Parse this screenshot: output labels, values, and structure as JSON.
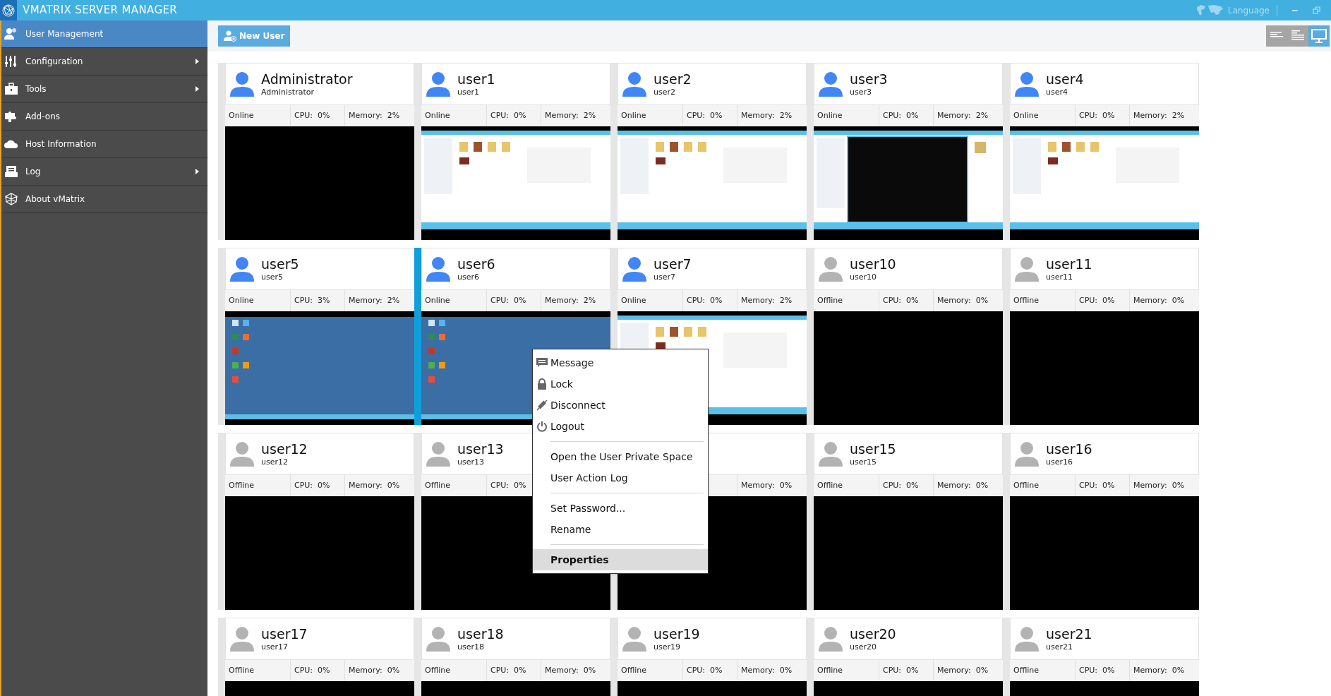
{
  "window": {
    "title": "VMATRIX SERVER MANAGER",
    "language": "Language"
  },
  "sidebar": {
    "items": [
      {
        "label": "User Management",
        "selected": true,
        "submenu": false
      },
      {
        "label": "Configuration",
        "selected": false,
        "submenu": true
      },
      {
        "label": "Tools",
        "selected": false,
        "submenu": true
      },
      {
        "label": "Add-ons",
        "selected": false,
        "submenu": false
      },
      {
        "label": "Host Information",
        "selected": false,
        "submenu": false
      },
      {
        "label": "Log",
        "selected": false,
        "submenu": true
      },
      {
        "label": "About vMatrix",
        "selected": false,
        "submenu": false
      }
    ]
  },
  "toolbar": {
    "new_user": "New User",
    "views": [
      {
        "selected": false
      },
      {
        "selected": false
      },
      {
        "selected": true
      }
    ]
  },
  "cards": [
    {
      "name": "Administrator",
      "login": "Administrator",
      "status": "Online",
      "online": true,
      "cpu": "CPU:  0%",
      "memory": "Memory:  2%",
      "selected": false
    },
    {
      "name": "user1",
      "login": "user1",
      "status": "Online",
      "online": true,
      "cpu": "CPU:  0%",
      "memory": "Memory:  2%",
      "selected": false
    },
    {
      "name": "user2",
      "login": "user2",
      "status": "Online",
      "online": true,
      "cpu": "CPU:  0%",
      "memory": "Memory:  2%",
      "selected": false
    },
    {
      "name": "user3",
      "login": "user3",
      "status": "Online",
      "online": true,
      "cpu": "CPU:  0%",
      "memory": "Memory:  2%",
      "selected": false
    },
    {
      "name": "user4",
      "login": "user4",
      "status": "Online",
      "online": true,
      "cpu": "CPU:  0%",
      "memory": "Memory:  2%",
      "selected": false
    },
    {
      "name": "user5",
      "login": "user5",
      "status": "Online",
      "online": true,
      "cpu": "CPU:  3%",
      "memory": "Memory:  2%",
      "selected": false
    },
    {
      "name": "user6",
      "login": "user6",
      "status": "Online",
      "online": true,
      "cpu": "CPU:  0%",
      "memory": "Memory:  2%",
      "selected": true
    },
    {
      "name": "user7",
      "login": "user7",
      "status": "Online",
      "online": true,
      "cpu": "CPU:  0%",
      "memory": "Memory:  2%",
      "selected": false
    },
    {
      "name": "user10",
      "login": "user10",
      "status": "Offline",
      "online": false,
      "cpu": "CPU:  0%",
      "memory": "Memory:  0%",
      "selected": false
    },
    {
      "name": "user11",
      "login": "user11",
      "status": "Offline",
      "online": false,
      "cpu": "CPU:  0%",
      "memory": "Memory:  0%",
      "selected": false
    },
    {
      "name": "user12",
      "login": "user12",
      "status": "Offline",
      "online": false,
      "cpu": "CPU:  0%",
      "memory": "Memory:  0%",
      "selected": false
    },
    {
      "name": "user13",
      "login": "user13",
      "status": "Offline",
      "online": false,
      "cpu": "CPU:  0%",
      "selected": false
    },
    {
      "memory": "Memory:  0%",
      "selected": false
    },
    {
      "name": "user15",
      "login": "user15",
      "status": "Offline",
      "online": false,
      "cpu": "CPU:  0%",
      "memory": "Memory:  0%",
      "selected": false
    },
    {
      "name": "user16",
      "login": "user16",
      "status": "Offline",
      "online": false,
      "cpu": "CPU:  0%",
      "memory": "Memory:  0%",
      "selected": false
    },
    {
      "name": "user17",
      "login": "user17",
      "status": "Offline",
      "online": false,
      "cpu": "CPU:  0%",
      "memory": "Memory:  0%",
      "selected": false
    },
    {
      "name": "user18",
      "login": "user18",
      "status": "Offline",
      "online": false,
      "cpu": "CPU:  0%",
      "memory": "Memory:  0%",
      "selected": false
    },
    {
      "name": "user19",
      "login": "user19",
      "status": "Offline",
      "online": false,
      "cpu": "CPU:  0%",
      "memory": "Memory:  0%",
      "selected": false
    },
    {
      "name": "user20",
      "login": "user20",
      "status": "Offline",
      "online": false,
      "cpu": "CPU:  0%",
      "memory": "Memory:  0%",
      "selected": false
    },
    {
      "name": "user21",
      "login": "user21",
      "status": "Offline",
      "online": false,
      "cpu": "CPU:  0%",
      "memory": "Memory:  0%",
      "selected": false
    }
  ],
  "context_menu": {
    "groups": [
      [
        {
          "label": "Message",
          "selected": false,
          "default": false
        },
        {
          "label": "Lock",
          "selected": false,
          "default": false
        },
        {
          "label": "Disconnect",
          "selected": false,
          "default": false
        },
        {
          "label": "Logout",
          "selected": false,
          "default": false
        }
      ],
      [
        {
          "label": "Open the User Private Space",
          "selected": false,
          "default": false
        },
        {
          "label": "User Action Log",
          "selected": false,
          "default": false
        }
      ],
      [
        {
          "label": "Set Password...",
          "selected": false,
          "default": false
        },
        {
          "label": "Rename",
          "selected": false,
          "default": false
        }
      ],
      [
        {
          "label": "Properties",
          "selected": true,
          "default": true
        }
      ]
    ]
  }
}
